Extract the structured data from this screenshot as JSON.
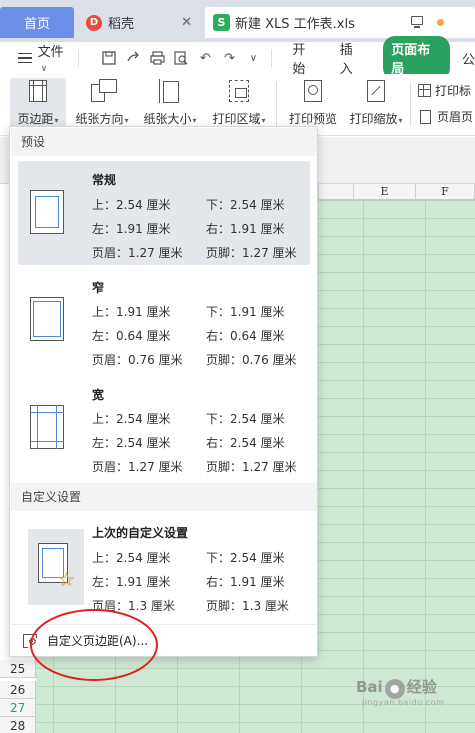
{
  "tabs": {
    "home": "首页",
    "daoke": "稻壳",
    "document": "新建 XLS 工作表.xls"
  },
  "menu": {
    "file": "文件",
    "items": [
      "开始",
      "插入",
      "页面布局",
      "公"
    ]
  },
  "ribbon": {
    "margin": "页边距",
    "orientation": "纸张方向",
    "size": "纸张大小",
    "print_area": "打印区域",
    "print_preview": "打印预览",
    "print_scale": "打印缩放",
    "print_title": "打印标",
    "header_footer": "页眉页"
  },
  "columns": [
    "E",
    "F"
  ],
  "rows": [
    "25",
    "26",
    "27",
    "28"
  ],
  "dropdown": {
    "presets_header": "预设",
    "custom_header": "自定义设置",
    "presets": [
      {
        "name": "常规",
        "top": "上：2.54 厘米",
        "bottom": "下：2.54 厘米",
        "left": "左：1.91 厘米",
        "right": "右：1.91 厘米",
        "header": "页眉：1.27 厘米",
        "footer": "页脚：1.27 厘米"
      },
      {
        "name": "窄",
        "top": "上：1.91 厘米",
        "bottom": "下：1.91 厘米",
        "left": "左：0.64 厘米",
        "right": "右：0.64 厘米",
        "header": "页眉：0.76 厘米",
        "footer": "页脚：0.76 厘米"
      },
      {
        "name": "宽",
        "top": "上：2.54 厘米",
        "bottom": "下：2.54 厘米",
        "left": "左：2.54 厘米",
        "right": "右：2.54 厘米",
        "header": "页眉：1.27 厘米",
        "footer": "页脚：1.27 厘米"
      }
    ],
    "last_custom": {
      "name": "上次的自定义设置",
      "top": "上：2.54 厘米",
      "bottom": "下：2.54 厘米",
      "left": "左：1.91 厘米",
      "right": "右：1.91 厘米",
      "header": "页眉：1.3 厘米",
      "footer": "页脚：1.3 厘米"
    },
    "custom_margin_link": "自定义页边距(A)..."
  },
  "watermark": {
    "text_a": "Bai",
    "text_b": "经验",
    "sub": "jingyan.baidu.com"
  }
}
